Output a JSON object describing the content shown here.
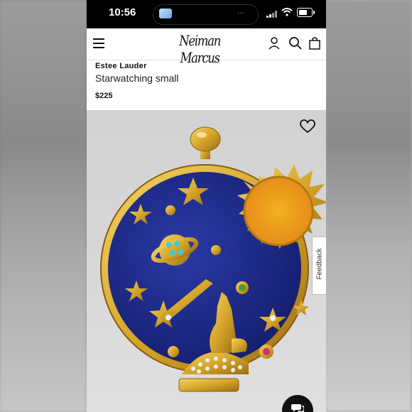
{
  "status_bar": {
    "time": "10:56",
    "center_indicator": "···"
  },
  "header": {
    "logo": "Neiman Marcus",
    "icons": [
      "menu-icon",
      "account-icon",
      "search-icon",
      "shopping-bag-icon"
    ]
  },
  "product": {
    "brand": "Estee Lauder",
    "name": "Starwatching small",
    "price": "$225"
  },
  "image": {
    "subject": "compact-illustration",
    "accent_gold": "#d6a62a",
    "accent_blue": "#1d2b86"
  },
  "buttons": {
    "wishlist": "heart-icon",
    "chat": "chat-icon"
  },
  "feedback_tab": {
    "label": "Feedback"
  }
}
